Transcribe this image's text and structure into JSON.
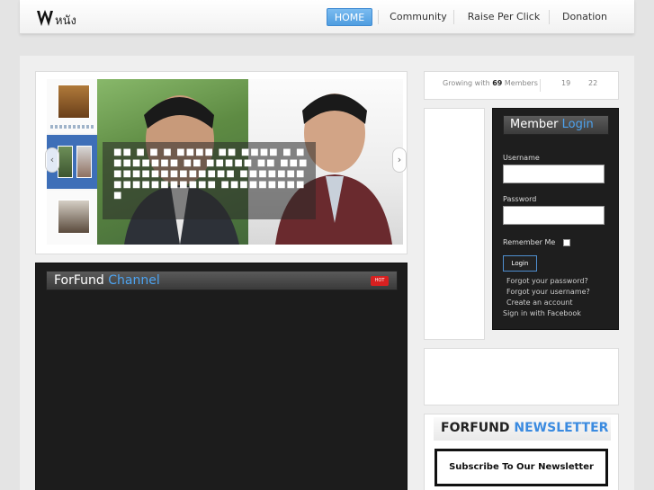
{
  "header": {
    "logo_alt": "Wหนัง",
    "nav": [
      {
        "label": "HOME"
      },
      {
        "label": "Community"
      },
      {
        "label": "Raise Per Click"
      },
      {
        "label": "Donation"
      }
    ]
  },
  "slider": {
    "caption": "■■ ■ ■ ■ ■■■■ ■■ ■■■■ ■ ■■■■■■■■ ■■ ■■■■■ ■■ ■■■■■■■■■■■■■■■■ ■■■■■■■■■■■■■■■■■■ ■■■■■■■■■■"
  },
  "channel": {
    "title_main": "ForFund",
    "title_accent": "Channel",
    "badge": "HOT"
  },
  "growing": {
    "prefix": "Growing with",
    "count": "69",
    "suffix": "Members",
    "num_a": "19",
    "num_b": "22"
  },
  "login": {
    "title_main": "Member",
    "title_accent": "Login",
    "username_label": "Username",
    "password_label": "Password",
    "remember_label": "Remember Me",
    "button": "Login",
    "forgot_password": "Forgot your password?",
    "forgot_username": "Forgot your username?",
    "create_account": "Create an account",
    "facebook": "Sign in with Facebook"
  },
  "newsletter": {
    "title_main": "FORFUND",
    "title_accent": "NEWSLETTER",
    "subscribe": "Subscribe To Our Newsletter"
  }
}
